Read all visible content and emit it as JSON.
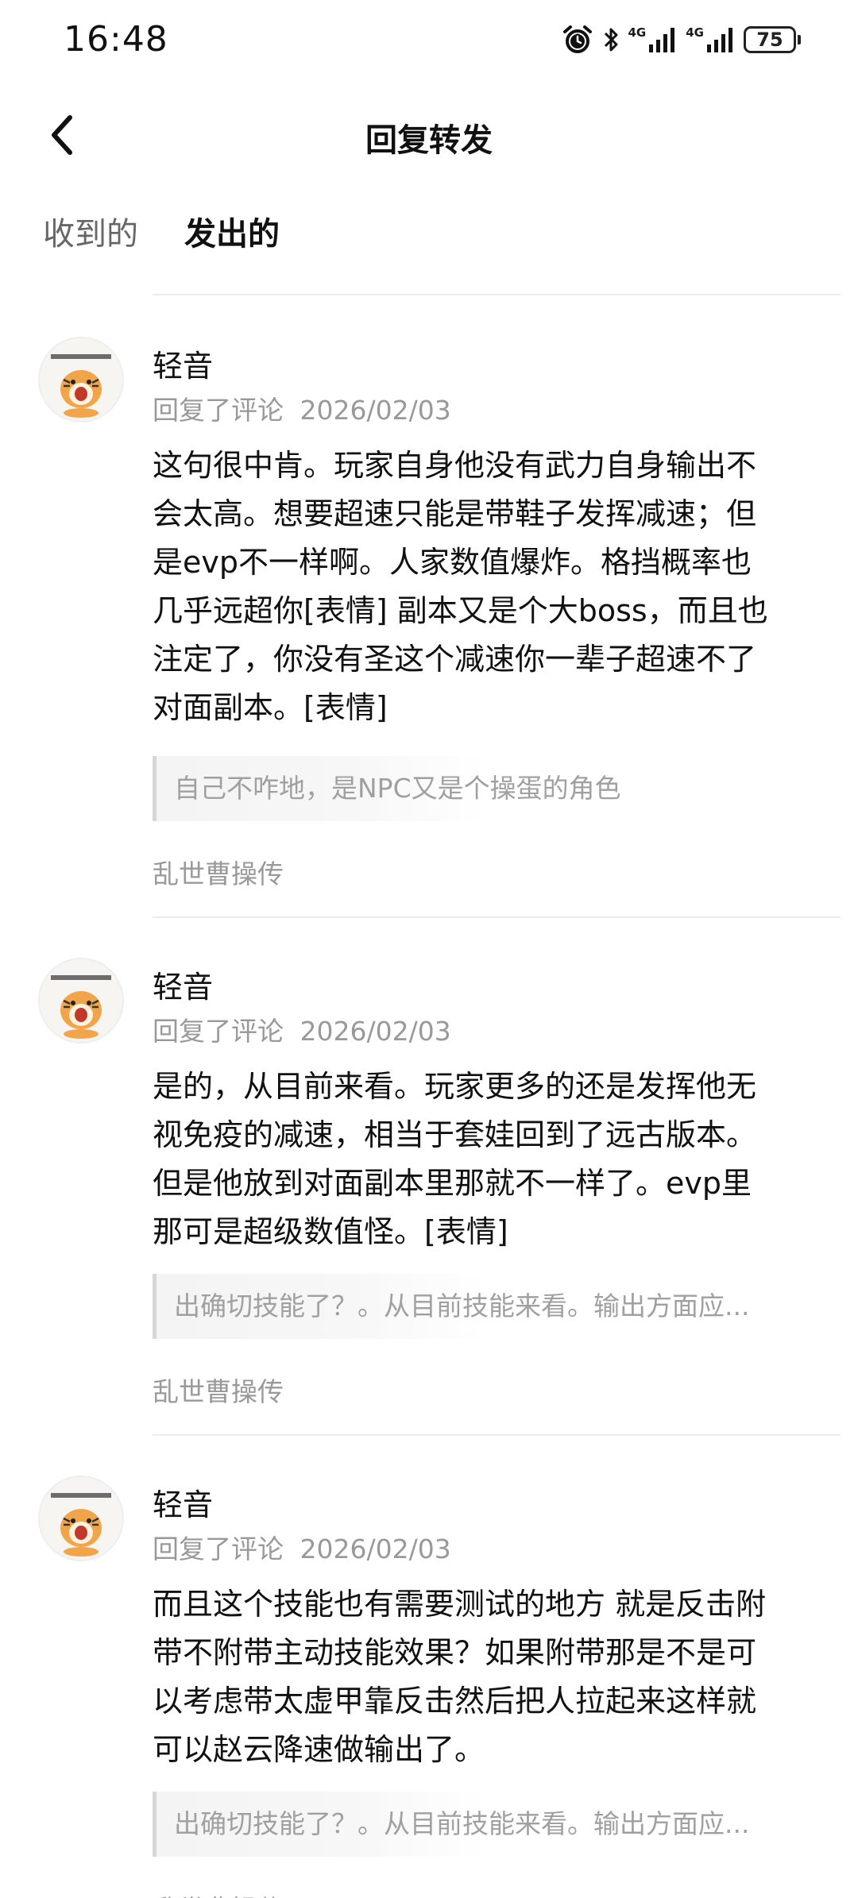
{
  "status": {
    "time": "16:48",
    "network1": "4G",
    "network2": "4G",
    "battery": "75"
  },
  "header": {
    "title": "回复转发"
  },
  "tabs": [
    {
      "label": "收到的"
    },
    {
      "label": "发出的"
    }
  ],
  "accent_color": "#2bc9b5",
  "items": [
    {
      "user": "轻音",
      "action": "回复了评论",
      "date": "2026/02/03",
      "content": "这句很中肯。玩家自身他没有武力自身输出不\n会太高。想要超速只能是带鞋子发挥减速；但\n是evp不一样啊。人家数值爆炸。格挡概率也\n几乎远超你[表情]  副本又是个大boss，而且也\n注定了，你没有圣这个减速你一辈子超速不了\n对面副本。[表情]",
      "quote": "自己不咋地，是NPC又是个操蛋的角色",
      "source": "乱世曹操传"
    },
    {
      "user": "轻音",
      "action": "回复了评论",
      "date": "2026/02/03",
      "content": "是的，从目前来看。玩家更多的还是发挥他无\n视免疫的减速，相当于套娃回到了远古版本。\n但是他放到对面副本里那就不一样了。evp里\n那可是超级数值怪。[表情]",
      "quote": "出确切技能了？。从目前技能来看。输出方面应...",
      "source": "乱世曹操传"
    },
    {
      "user": "轻音",
      "action": "回复了评论",
      "date": "2026/02/03",
      "content": "而且这个技能也有需要测试的地方 就是反击附\n带不附带主动技能效果？如果附带那是不是可\n以考虑带太虚甲靠反击然后把人拉起来这样就\n可以赵云降速做输出了。",
      "quote": "出确切技能了？。从目前技能来看。输出方面应...",
      "source": "乱世曹操传"
    }
  ]
}
